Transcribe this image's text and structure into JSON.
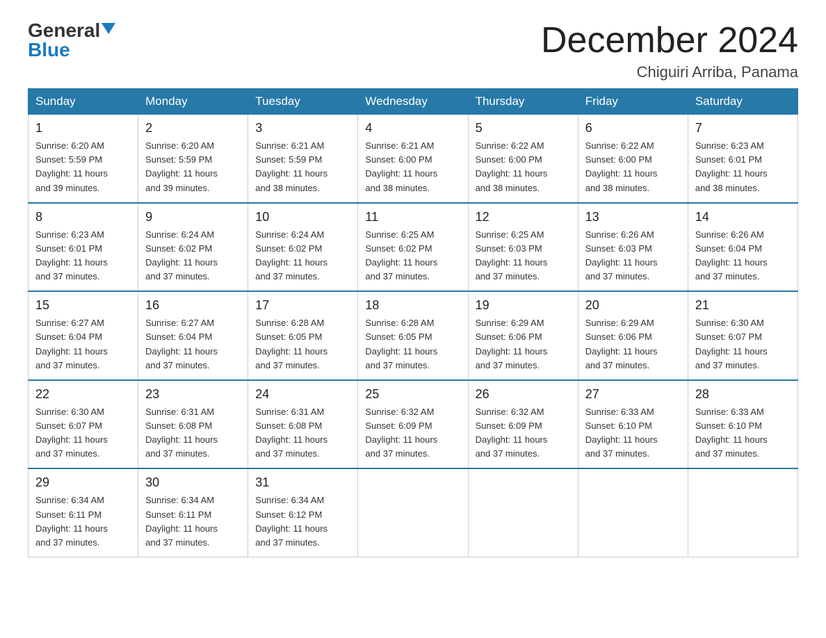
{
  "logo": {
    "general": "General",
    "blue": "Blue"
  },
  "title": "December 2024",
  "location": "Chiguiri Arriba, Panama",
  "days_of_week": [
    "Sunday",
    "Monday",
    "Tuesday",
    "Wednesday",
    "Thursday",
    "Friday",
    "Saturday"
  ],
  "weeks": [
    [
      {
        "day": "1",
        "sunrise": "6:20 AM",
        "sunset": "5:59 PM",
        "daylight": "11 hours and 39 minutes."
      },
      {
        "day": "2",
        "sunrise": "6:20 AM",
        "sunset": "5:59 PM",
        "daylight": "11 hours and 39 minutes."
      },
      {
        "day": "3",
        "sunrise": "6:21 AM",
        "sunset": "5:59 PM",
        "daylight": "11 hours and 38 minutes."
      },
      {
        "day": "4",
        "sunrise": "6:21 AM",
        "sunset": "6:00 PM",
        "daylight": "11 hours and 38 minutes."
      },
      {
        "day": "5",
        "sunrise": "6:22 AM",
        "sunset": "6:00 PM",
        "daylight": "11 hours and 38 minutes."
      },
      {
        "day": "6",
        "sunrise": "6:22 AM",
        "sunset": "6:00 PM",
        "daylight": "11 hours and 38 minutes."
      },
      {
        "day": "7",
        "sunrise": "6:23 AM",
        "sunset": "6:01 PM",
        "daylight": "11 hours and 38 minutes."
      }
    ],
    [
      {
        "day": "8",
        "sunrise": "6:23 AM",
        "sunset": "6:01 PM",
        "daylight": "11 hours and 37 minutes."
      },
      {
        "day": "9",
        "sunrise": "6:24 AM",
        "sunset": "6:02 PM",
        "daylight": "11 hours and 37 minutes."
      },
      {
        "day": "10",
        "sunrise": "6:24 AM",
        "sunset": "6:02 PM",
        "daylight": "11 hours and 37 minutes."
      },
      {
        "day": "11",
        "sunrise": "6:25 AM",
        "sunset": "6:02 PM",
        "daylight": "11 hours and 37 minutes."
      },
      {
        "day": "12",
        "sunrise": "6:25 AM",
        "sunset": "6:03 PM",
        "daylight": "11 hours and 37 minutes."
      },
      {
        "day": "13",
        "sunrise": "6:26 AM",
        "sunset": "6:03 PM",
        "daylight": "11 hours and 37 minutes."
      },
      {
        "day": "14",
        "sunrise": "6:26 AM",
        "sunset": "6:04 PM",
        "daylight": "11 hours and 37 minutes."
      }
    ],
    [
      {
        "day": "15",
        "sunrise": "6:27 AM",
        "sunset": "6:04 PM",
        "daylight": "11 hours and 37 minutes."
      },
      {
        "day": "16",
        "sunrise": "6:27 AM",
        "sunset": "6:04 PM",
        "daylight": "11 hours and 37 minutes."
      },
      {
        "day": "17",
        "sunrise": "6:28 AM",
        "sunset": "6:05 PM",
        "daylight": "11 hours and 37 minutes."
      },
      {
        "day": "18",
        "sunrise": "6:28 AM",
        "sunset": "6:05 PM",
        "daylight": "11 hours and 37 minutes."
      },
      {
        "day": "19",
        "sunrise": "6:29 AM",
        "sunset": "6:06 PM",
        "daylight": "11 hours and 37 minutes."
      },
      {
        "day": "20",
        "sunrise": "6:29 AM",
        "sunset": "6:06 PM",
        "daylight": "11 hours and 37 minutes."
      },
      {
        "day": "21",
        "sunrise": "6:30 AM",
        "sunset": "6:07 PM",
        "daylight": "11 hours and 37 minutes."
      }
    ],
    [
      {
        "day": "22",
        "sunrise": "6:30 AM",
        "sunset": "6:07 PM",
        "daylight": "11 hours and 37 minutes."
      },
      {
        "day": "23",
        "sunrise": "6:31 AM",
        "sunset": "6:08 PM",
        "daylight": "11 hours and 37 minutes."
      },
      {
        "day": "24",
        "sunrise": "6:31 AM",
        "sunset": "6:08 PM",
        "daylight": "11 hours and 37 minutes."
      },
      {
        "day": "25",
        "sunrise": "6:32 AM",
        "sunset": "6:09 PM",
        "daylight": "11 hours and 37 minutes."
      },
      {
        "day": "26",
        "sunrise": "6:32 AM",
        "sunset": "6:09 PM",
        "daylight": "11 hours and 37 minutes."
      },
      {
        "day": "27",
        "sunrise": "6:33 AM",
        "sunset": "6:10 PM",
        "daylight": "11 hours and 37 minutes."
      },
      {
        "day": "28",
        "sunrise": "6:33 AM",
        "sunset": "6:10 PM",
        "daylight": "11 hours and 37 minutes."
      }
    ],
    [
      {
        "day": "29",
        "sunrise": "6:34 AM",
        "sunset": "6:11 PM",
        "daylight": "11 hours and 37 minutes."
      },
      {
        "day": "30",
        "sunrise": "6:34 AM",
        "sunset": "6:11 PM",
        "daylight": "11 hours and 37 minutes."
      },
      {
        "day": "31",
        "sunrise": "6:34 AM",
        "sunset": "6:12 PM",
        "daylight": "11 hours and 37 minutes."
      },
      null,
      null,
      null,
      null
    ]
  ],
  "labels": {
    "sunrise_prefix": "Sunrise: ",
    "sunset_prefix": "Sunset: ",
    "daylight_prefix": "Daylight: "
  }
}
